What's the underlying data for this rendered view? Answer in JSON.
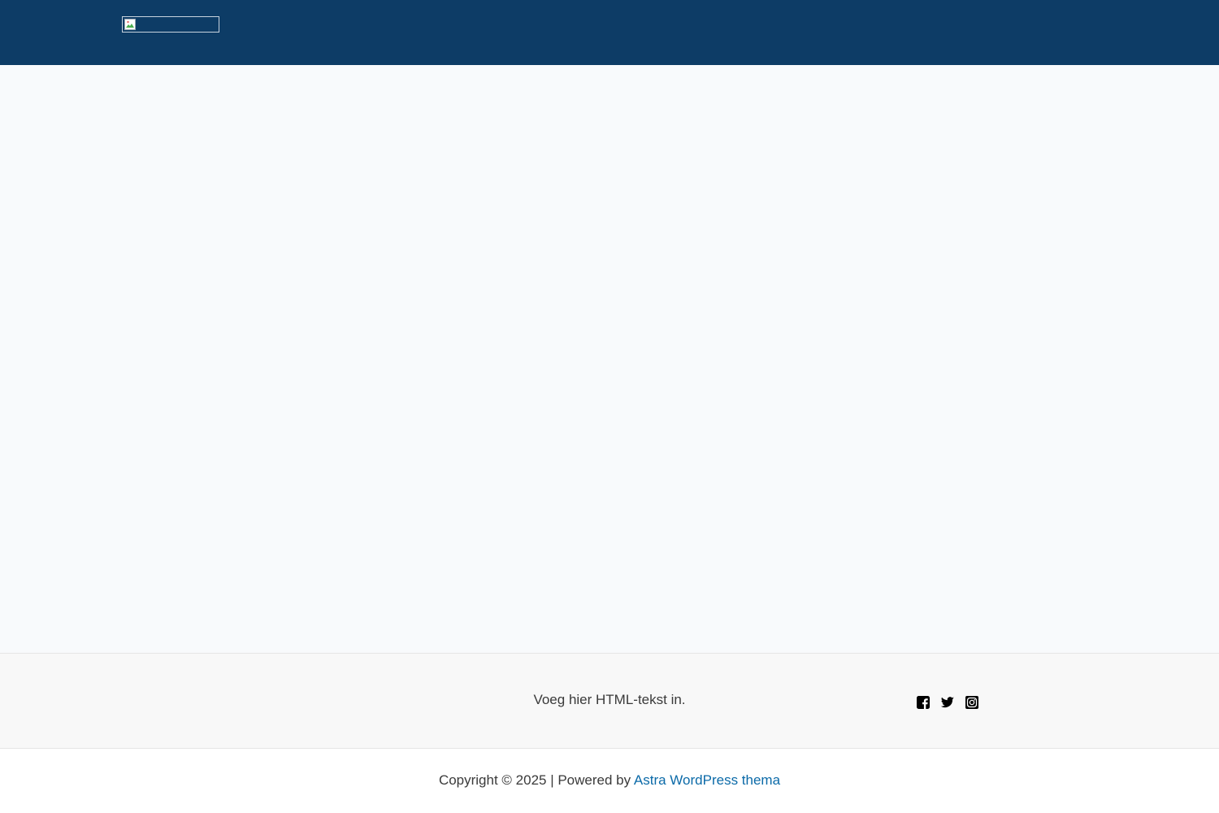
{
  "colors": {
    "header_bg": "#0d3c66",
    "content_bg": "#f8fafc",
    "footer_bg": "#f8f8f8",
    "link": "#0b6aa8"
  },
  "header": {
    "logo_icon": "broken-image-icon"
  },
  "footer": {
    "html_text": "Voeg hier HTML-tekst in.",
    "social": [
      {
        "icon": "facebook-icon"
      },
      {
        "icon": "twitter-icon"
      },
      {
        "icon": "instagram-icon"
      }
    ]
  },
  "copyright": {
    "prefix": "Copyright © 2025 | Powered by ",
    "link_label": "Astra WordPress thema"
  }
}
